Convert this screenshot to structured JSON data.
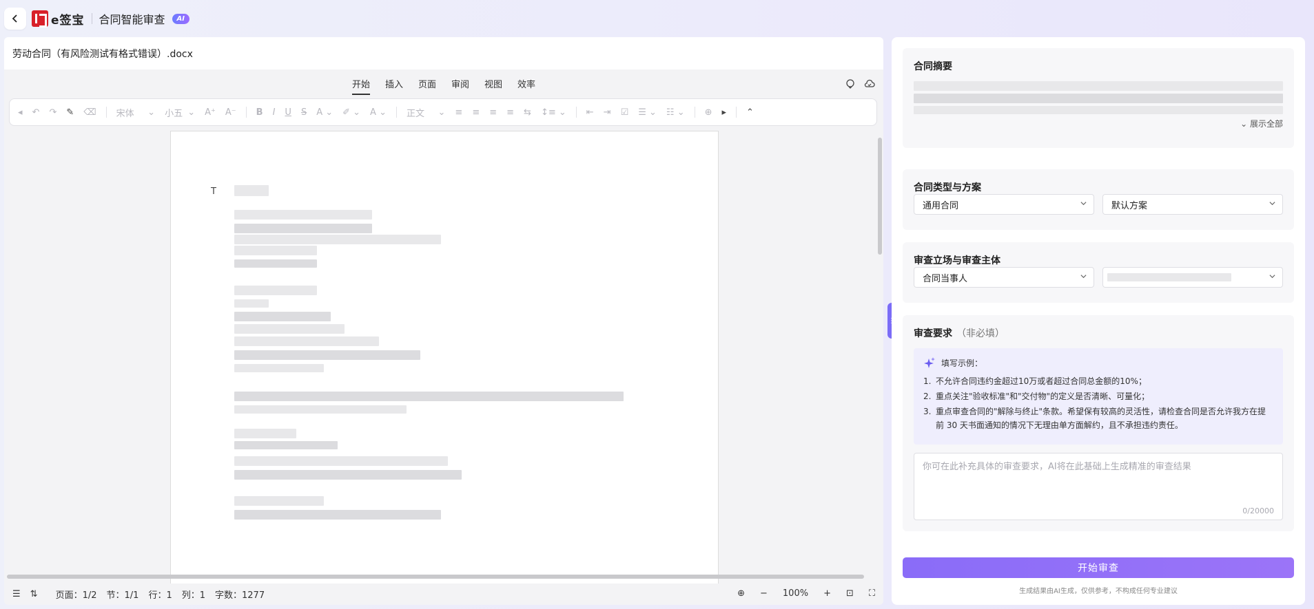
{
  "topbar": {
    "brand": "e签宝",
    "app_title": "合同智能审查",
    "ai_badge": "AI"
  },
  "editor": {
    "file_name": "劳动合同（有风险测试有格式错误）.docx",
    "menu_tabs": [
      "开始",
      "插入",
      "页面",
      "审阅",
      "视图",
      "效率"
    ],
    "active_tab": "开始",
    "toolbar": {
      "font_family": "宋体",
      "font_size": "小五",
      "paragraph_style": "正文"
    },
    "status": {
      "page": "页面：1/2",
      "section": "节：1/1",
      "row": "行：1",
      "col": "列：1",
      "word_count": "字数：1277",
      "zoom": "100%"
    }
  },
  "panel": {
    "summary": {
      "title": "合同摘要",
      "show_all": "展示全部"
    },
    "type_plan": {
      "title": "合同类型与方案",
      "contract_type": "通用合同",
      "plan": "默认方案"
    },
    "stance": {
      "title": "审查立场与审查主体",
      "stance_value": "合同当事人"
    },
    "requirements": {
      "title": "审查要求",
      "optional": "（非必填）",
      "example_head": "填写示例：",
      "examples": [
        {
          "n": "1.",
          "text": "不允许合同违约金超过10万或者超过合同总金额的10%；"
        },
        {
          "n": "2.",
          "text": "重点关注\"验收标准\"和\"交付物\"的定义是否清晰、可量化；"
        },
        {
          "n": "3.",
          "text": "重点审查合同的\"解除与终止\"条款。希望保有较高的灵活性，请检查合同是否允许我方在提前 30 天书面通知的情况下无理由单方面解约，且不承担违约责任。"
        }
      ],
      "placeholder": "你可在此补充具体的审查要求，AI将在此基础上生成精准的审查结果",
      "counter": "0/20000"
    },
    "start_button": "开始审查",
    "disclaimer": "生成结果由AI生成，仅供参考，不构成任何专业建议"
  }
}
